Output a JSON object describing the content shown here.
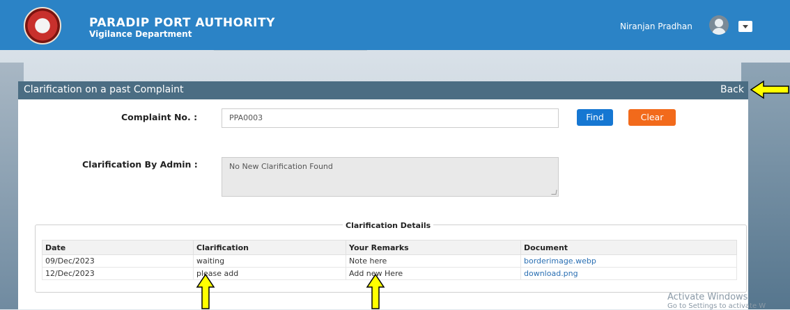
{
  "header": {
    "org_name": "PARADIP PORT AUTHORITY",
    "department": "Vigilance Department",
    "user_name": "Niranjan Pradhan"
  },
  "panel": {
    "title": "Clarification on a past Complaint",
    "back_label": "Back"
  },
  "form": {
    "complaint_label": "Complaint No. :",
    "complaint_value": "PPA0003",
    "find_label": "Find",
    "clear_label": "Clear",
    "clarification_admin_label": "Clarification By Admin :",
    "clarification_admin_value": "No New Clarification Found"
  },
  "details": {
    "legend": "Clarification Details",
    "columns": [
      "Date",
      "Clarification",
      "Your Remarks",
      "Document"
    ],
    "rows": [
      {
        "date": "09/Dec/2023",
        "clarification": "waiting",
        "remarks": "Note here",
        "document": "borderimage.webp"
      },
      {
        "date": "12/Dec/2023",
        "clarification": "please add",
        "remarks": "Add new Here",
        "document": "download.png"
      }
    ]
  },
  "watermark": {
    "line1": "Activate Windows",
    "line2": "Go to Settings to activate W"
  },
  "colors": {
    "header": "#2b83c6",
    "panel_title": "#4b6d83",
    "find_button": "#1677d2",
    "clear_button": "#f26a1b",
    "annotation_arrow": "#ffff00"
  }
}
